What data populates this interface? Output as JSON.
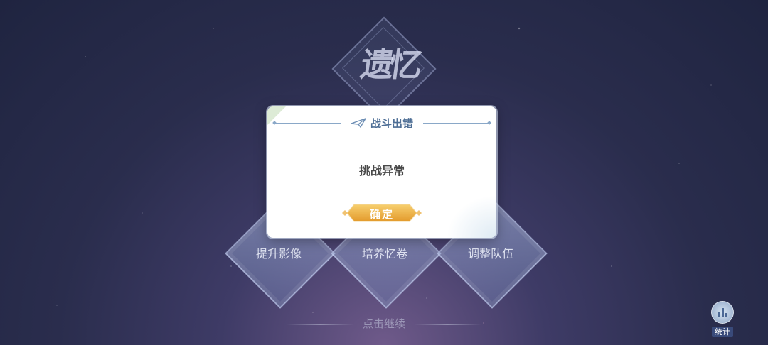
{
  "emblem": {
    "text": "遗忆"
  },
  "options": [
    {
      "label": "提升影像"
    },
    {
      "label": "培养忆卷"
    },
    {
      "label": "调整队伍"
    }
  ],
  "continue_hint": "点击继续",
  "stats_button": {
    "label": "统计",
    "icon": "bar-chart-icon"
  },
  "dialog": {
    "title": "战斗出错",
    "title_icon": "paper-plane-icon",
    "message": "挑战异常",
    "confirm_label": "确定"
  },
  "colors": {
    "title": "#4f6f96",
    "confirm_gold": "#e8a83a",
    "background": "#2a2d4d"
  }
}
